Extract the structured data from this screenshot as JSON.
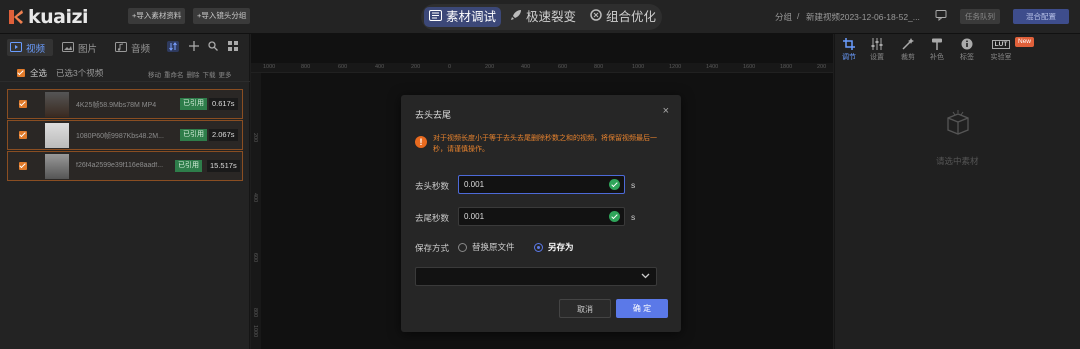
{
  "app": {
    "logo_text": "kuaizi"
  },
  "toolbar": {
    "import_material": "+导入素材资料",
    "import_shot": "+导入镜头分组"
  },
  "modes": [
    {
      "label": "素材调试"
    },
    {
      "label": "极速裂变"
    },
    {
      "label": "组合优化"
    }
  ],
  "header": {
    "crumb_group": "分组",
    "crumb_sep": "/",
    "crumb_name": "新建视频2023-12-06-18-52_...",
    "task_queue": "任务队列",
    "export": "混合配置"
  },
  "left": {
    "tabs": [
      {
        "label": "视频"
      },
      {
        "label": "图片"
      },
      {
        "label": "音频"
      }
    ],
    "select_all": "全选",
    "selected_count": "已选3个视频",
    "actions": [
      "移动",
      "重命名",
      "删除",
      "下载",
      "更多"
    ],
    "items": [
      {
        "name": "4K25帧58.9Mbs78M MP4",
        "status": "已引用",
        "duration": "0.617s"
      },
      {
        "name": "1080P60帧9987Kbs48.2M...",
        "status": "已引用",
        "duration": "2.067s"
      },
      {
        "name": "f26f4a2599e39f116e8aadf...",
        "status": "已引用",
        "duration": "15.517s"
      }
    ]
  },
  "ruler": {
    "h": [
      "1000",
      "800",
      "600",
      "400",
      "200",
      "0",
      "200",
      "400",
      "600",
      "800",
      "1000",
      "1200",
      "1400",
      "1600",
      "1800",
      "200"
    ],
    "v": [
      "200",
      "400",
      "600",
      "800",
      "1000"
    ]
  },
  "right": {
    "tabs": [
      {
        "label": "调节"
      },
      {
        "label": "设置"
      },
      {
        "label": "裁剪"
      },
      {
        "label": "补色"
      },
      {
        "label": "标签"
      },
      {
        "label": "实验室"
      }
    ],
    "lab_badge": "New",
    "lut_text": "LUT",
    "empty_text": "请选中素材"
  },
  "dialog": {
    "title": "去头去尾",
    "close": "×",
    "warning": "对于视频长度小于等于去头去尾删除秒数之和的视频，将保留视频最后一秒，请谨慎操作。",
    "head_label": "去头秒数",
    "head_value": "0.001",
    "tail_label": "去尾秒数",
    "tail_value": "0.001",
    "unit": "s",
    "save_label": "保存方式",
    "opt_replace": "替换原文件",
    "opt_saveas": "另存为",
    "cancel": "取消",
    "confirm": "确 定"
  }
}
